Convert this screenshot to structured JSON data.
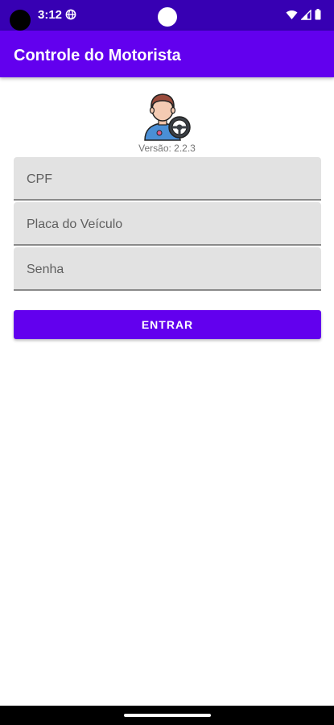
{
  "status_bar": {
    "time": "3:12",
    "icons": [
      "globe-icon",
      "wifi-icon",
      "signal-icon",
      "battery-icon"
    ]
  },
  "app_bar": {
    "title": "Controle do Motorista",
    "color": "#6200ee"
  },
  "header": {
    "logo": "driver-with-steering-wheel-icon",
    "version": "Versão: 2.2.3"
  },
  "form": {
    "cpf_placeholder": "CPF",
    "placa_placeholder": "Placa do Veículo",
    "senha_placeholder": "Senha",
    "submit_label": "ENTRAR"
  },
  "colors": {
    "status_bar": "#3700b3",
    "primary": "#6200ee",
    "field_bg": "#e2e2e2"
  }
}
